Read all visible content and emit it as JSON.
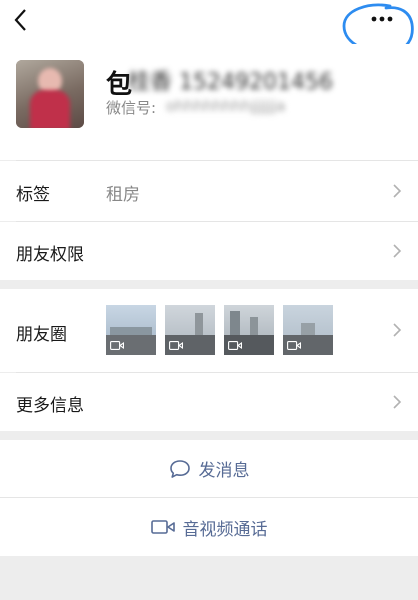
{
  "header": {
    "back_icon": "chevron-left-icon",
    "more_icon": "ellipsis-icon"
  },
  "profile": {
    "name_first_char": "包",
    "name_rest_blurred": "桂香 15249201456",
    "wechat_id_label": "微信号:",
    "wechat_id_blurred": "ohhhhhhhhjjjjjja"
  },
  "rows": {
    "tags": {
      "label": "标签",
      "value": "租房"
    },
    "permissions": {
      "label": "朋友权限"
    },
    "moments": {
      "label": "朋友圈"
    },
    "more_info": {
      "label": "更多信息"
    }
  },
  "actions": {
    "message": {
      "label": "发消息",
      "icon": "chat-bubble-icon"
    },
    "call": {
      "label": "音视频通话",
      "icon": "video-camera-icon"
    }
  },
  "colors": {
    "link": "#576b95",
    "annotation": "#2d8cf0"
  }
}
